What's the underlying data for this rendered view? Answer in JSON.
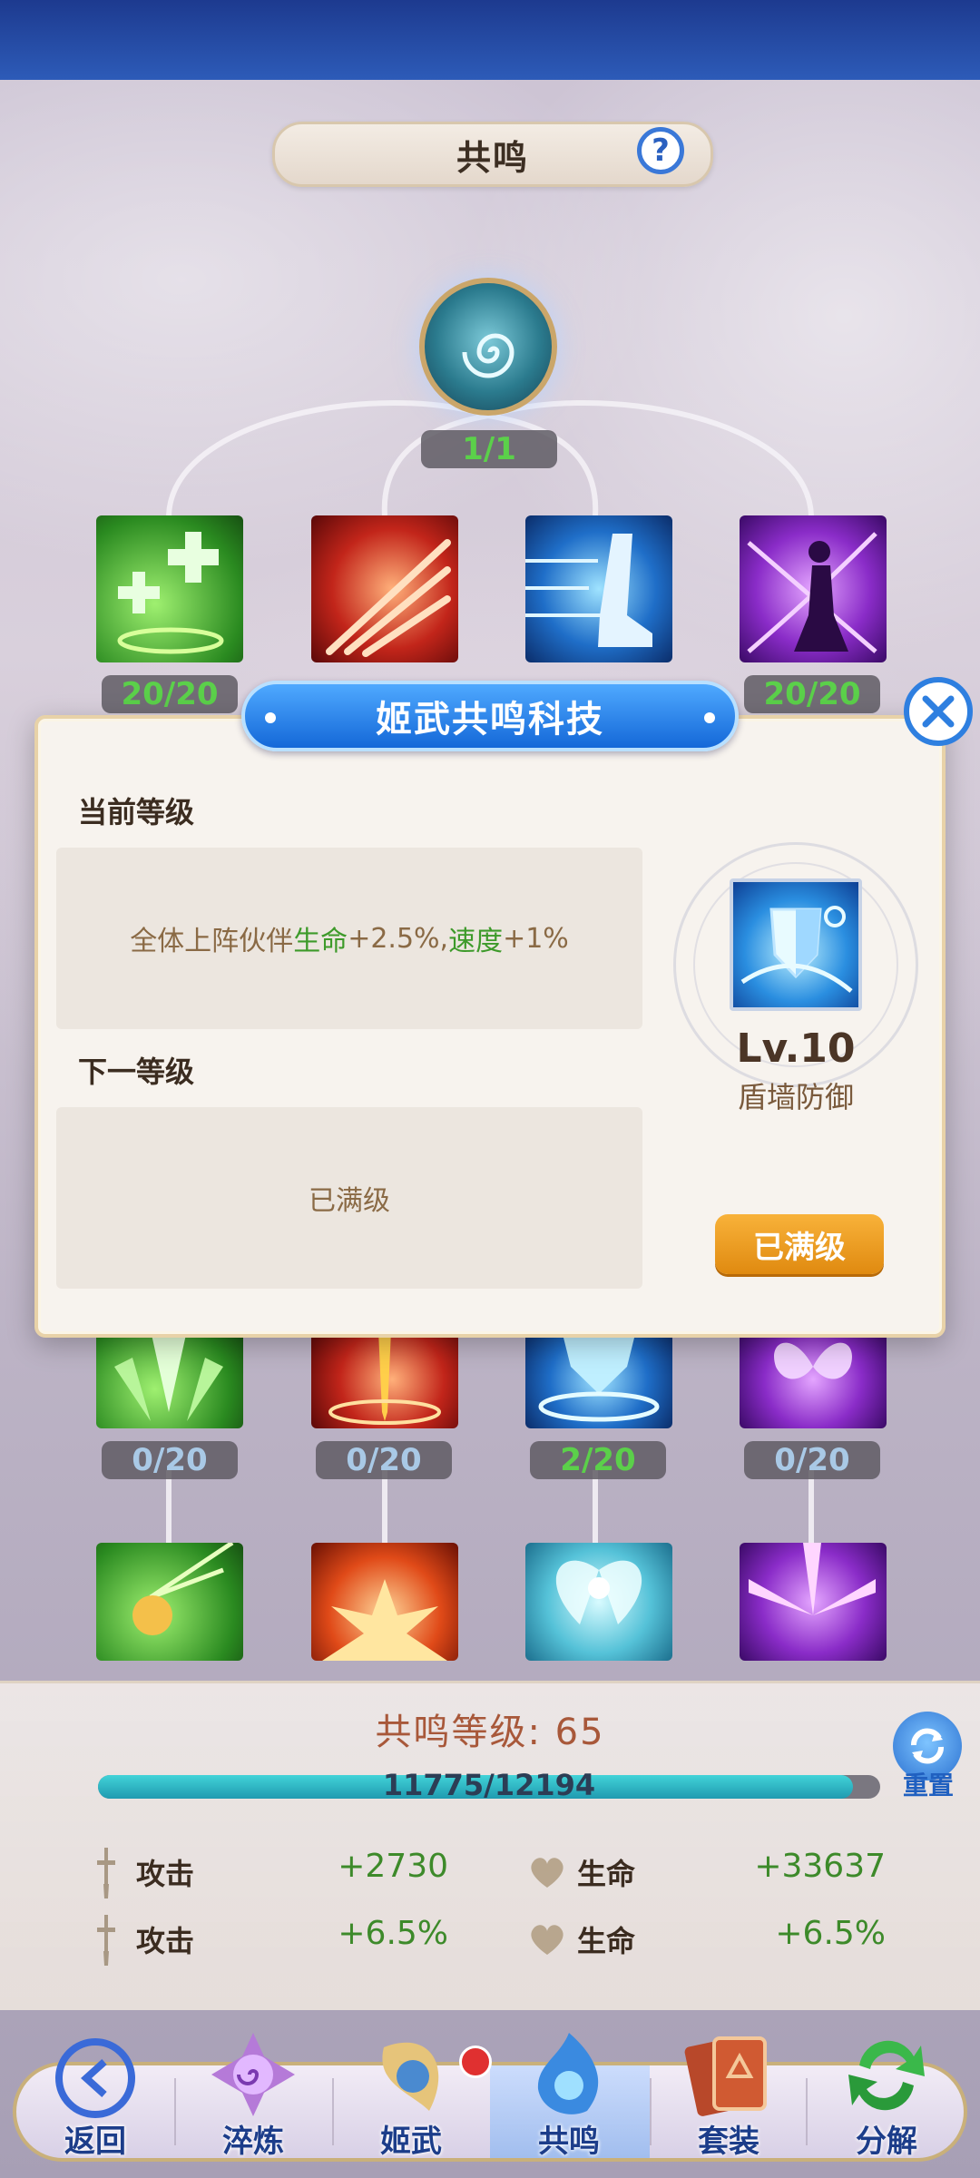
{
  "header": {
    "title": "共鸣",
    "help_icon": "question-icon"
  },
  "tree": {
    "root": {
      "count": "1/1"
    },
    "tier1": [
      {
        "count": "20/20",
        "color": "#3a9a2a"
      },
      {
        "count": "",
        "color": "#c2251a"
      },
      {
        "count": "",
        "color": "#1f6ec8"
      },
      {
        "count": "20/20",
        "color": "#8a2cc8"
      }
    ],
    "tier2": [
      {
        "count": "0/20"
      },
      {
        "count": "0/20"
      },
      {
        "count": "2/20"
      },
      {
        "count": "0/20"
      }
    ]
  },
  "modal": {
    "title": "姬武共鸣科技",
    "current_label": "当前等级",
    "current_prefix": "全体上阵伙伴",
    "current_stat1": "生命",
    "current_val1": "+2.5%,",
    "current_stat2": "速度",
    "current_val2": "+1%",
    "next_label": "下一等级",
    "next_text": "已满级",
    "skill_level": "Lv.10",
    "skill_name": "盾墙防御",
    "max_button": "已满级"
  },
  "resonance": {
    "level_text": "共鸣等级: 65",
    "progress_text": "11775/12194",
    "progress": 0.9656,
    "reset_label": "重置",
    "stats": [
      {
        "label": "攻击",
        "value": "+2730"
      },
      {
        "label": "生命",
        "value": "+33637"
      },
      {
        "label": "攻击",
        "value": "+6.5%"
      },
      {
        "label": "生命",
        "value": "+6.5%"
      }
    ]
  },
  "nav": {
    "items": [
      {
        "label": "返回",
        "icon": "back-icon"
      },
      {
        "label": "淬炼",
        "icon": "refine-icon"
      },
      {
        "label": "姬武",
        "icon": "weapon-icon"
      },
      {
        "label": "共鸣",
        "icon": "resonance-icon"
      },
      {
        "label": "套装",
        "icon": "set-icon"
      },
      {
        "label": "分解",
        "icon": "decompose-icon"
      }
    ],
    "active": "共鸣"
  }
}
